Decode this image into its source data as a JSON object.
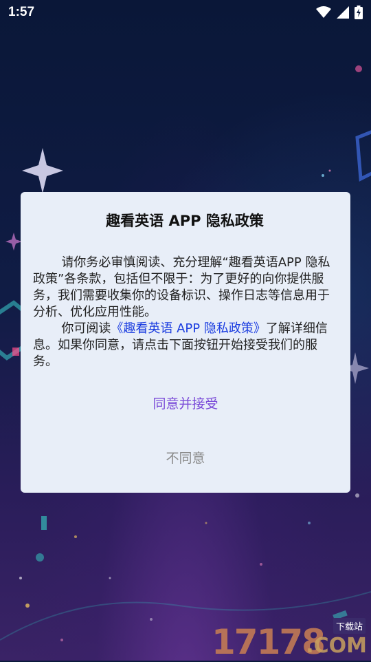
{
  "status_bar": {
    "time": "1:57",
    "icons": [
      "wifi-icon",
      "signal-icon",
      "battery-charging-icon"
    ]
  },
  "dialog": {
    "title": "趣看英语 APP 隐私政策",
    "paragraph1": "请你务必审慎阅读、充分理解“趣看英语APP 隐私政策”各条款，包括但不限于：为了更好的向你提供服务，我们需要收集你的设备标识、操作日志等信息用于分析、优化应用性能。",
    "paragraph2_prefix": "你可阅读",
    "paragraph2_link": "《趣看英语 APP 隐私政策》",
    "paragraph2_suffix": "了解详细信息。如果你同意，请点击下面按钮开始接受我们的服务。",
    "accept_label": "同意并接受",
    "decline_label": "不同意"
  },
  "watermark": {
    "digits": "17178",
    "site": ".COM",
    "tag": "下载站"
  },
  "colors": {
    "accent": "#7a4ad8",
    "link": "#1a3ce0",
    "dialog_bg": "#e8eef8"
  }
}
